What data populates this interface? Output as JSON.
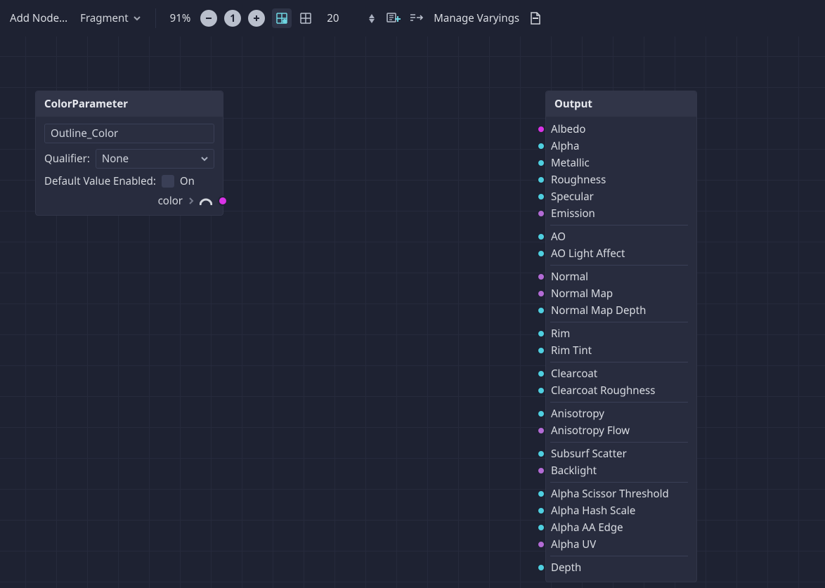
{
  "toolbar": {
    "add_node_label": "Add Node...",
    "shader_type": "Fragment",
    "zoom_label": "91%",
    "grid_size": "20",
    "manage_varyings_label": "Manage Varyings"
  },
  "nodes": {
    "color_parameter": {
      "title": "ColorParameter",
      "name_value": "Outline_Color",
      "qualifier_label": "Qualifier:",
      "qualifier_value": "None",
      "default_enabled_label": "Default Value Enabled:",
      "default_enabled_text": "On",
      "output_port_label": "color"
    },
    "output": {
      "title": "Output",
      "groups": [
        [
          {
            "label": "Albedo",
            "type": "vec3",
            "active": true
          },
          {
            "label": "Alpha",
            "type": "scalar"
          },
          {
            "label": "Metallic",
            "type": "scalar"
          },
          {
            "label": "Roughness",
            "type": "scalar"
          },
          {
            "label": "Specular",
            "type": "scalar"
          },
          {
            "label": "Emission",
            "type": "vec3"
          }
        ],
        [
          {
            "label": "AO",
            "type": "scalar"
          },
          {
            "label": "AO Light Affect",
            "type": "scalar"
          }
        ],
        [
          {
            "label": "Normal",
            "type": "vec3"
          },
          {
            "label": "Normal Map",
            "type": "vec3"
          },
          {
            "label": "Normal Map Depth",
            "type": "scalar"
          }
        ],
        [
          {
            "label": "Rim",
            "type": "scalar"
          },
          {
            "label": "Rim Tint",
            "type": "scalar"
          }
        ],
        [
          {
            "label": "Clearcoat",
            "type": "scalar"
          },
          {
            "label": "Clearcoat Roughness",
            "type": "scalar"
          }
        ],
        [
          {
            "label": "Anisotropy",
            "type": "scalar"
          },
          {
            "label": "Anisotropy Flow",
            "type": "vec3"
          }
        ],
        [
          {
            "label": "Subsurf Scatter",
            "type": "scalar"
          },
          {
            "label": "Backlight",
            "type": "vec3"
          }
        ],
        [
          {
            "label": "Alpha Scissor Threshold",
            "type": "scalar"
          },
          {
            "label": "Alpha Hash Scale",
            "type": "scalar"
          },
          {
            "label": "Alpha AA Edge",
            "type": "scalar"
          },
          {
            "label": "Alpha UV",
            "type": "vec3"
          }
        ],
        [
          {
            "label": "Depth",
            "type": "scalar"
          }
        ]
      ]
    }
  },
  "colors": {
    "wire": "#d933e6",
    "port_vec3": "#b36bd5",
    "port_scalar": "#4fcfe0"
  }
}
